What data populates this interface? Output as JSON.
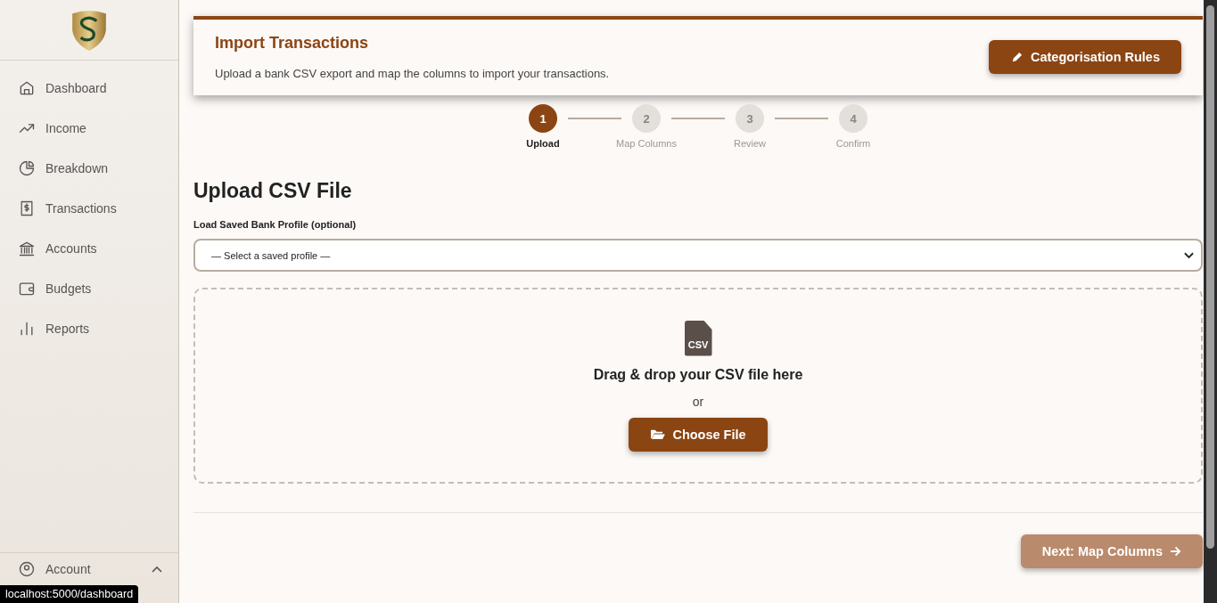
{
  "sidebar": {
    "items": [
      {
        "label": "Dashboard",
        "selected": false
      },
      {
        "label": "Income",
        "selected": false
      },
      {
        "label": "Breakdown",
        "selected": false
      },
      {
        "label": "Transactions",
        "selected": false
      },
      {
        "label": "Accounts",
        "selected": false
      },
      {
        "label": "Budgets",
        "selected": false
      },
      {
        "label": "Reports",
        "selected": false
      }
    ],
    "account": {
      "label": "Account",
      "expanded": true
    }
  },
  "header": {
    "title": "Import Transactions",
    "subtitle": "Upload a bank CSV export and map the columns to import your transactions.",
    "button": "Categorisation Rules"
  },
  "steps": [
    {
      "number": "1",
      "label": "Upload",
      "selected": true
    },
    {
      "number": "2",
      "label": "Map Columns",
      "selected": false
    },
    {
      "number": "3",
      "label": "Review",
      "selected": false
    },
    {
      "number": "4",
      "label": "Confirm",
      "selected": false
    }
  ],
  "upload": {
    "heading": "Upload CSV File",
    "profile_label": "Load Saved Bank Profile (optional)",
    "profile_value": "— Select a saved profile —",
    "file_icon_text": "CSV",
    "drop_text": "Drag & drop your CSV file here",
    "or_text": "or",
    "choose_button": "Choose File"
  },
  "next_button": {
    "label": "Next: Map Columns",
    "disabled": true
  },
  "status_bar": "localhost:5000/dashboard"
}
